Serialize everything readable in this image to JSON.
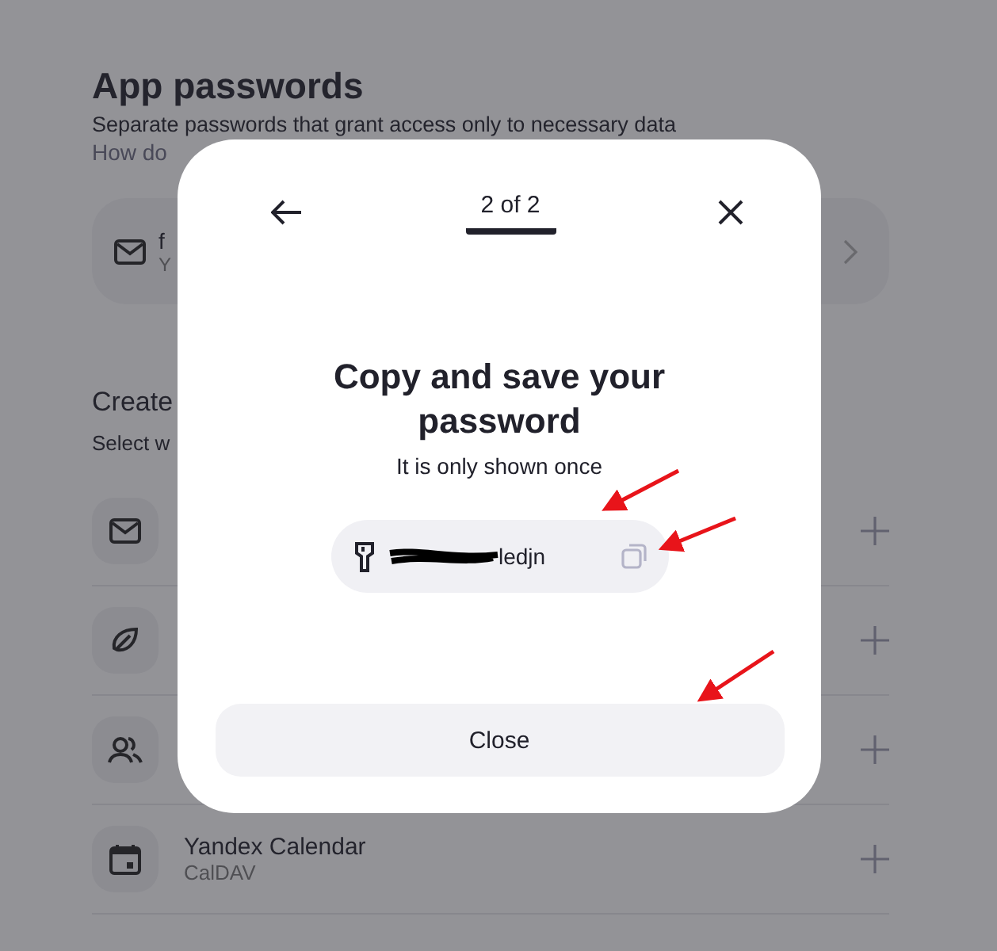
{
  "page": {
    "title": "App passwords",
    "description": "Separate passwords that grant access only to necessary data",
    "link": "How do",
    "existing_card": {
      "name": "f",
      "subtitle": "Y"
    },
    "create_heading": "Create",
    "create_hint": "Select w",
    "services": [
      {
        "kind": "mail"
      },
      {
        "kind": "disk"
      },
      {
        "kind": "contacts"
      },
      {
        "kind": "calendar",
        "name": "Yandex Calendar",
        "protocol": "CalDAV"
      }
    ]
  },
  "dialog": {
    "step": "2 of 2",
    "title": "Copy and save your password",
    "hint": "It is only shown once",
    "password": "ledjn",
    "close_button": "Close"
  },
  "annotations": [
    {
      "kind": "arrow"
    },
    {
      "kind": "arrow"
    },
    {
      "kind": "arrow"
    }
  ]
}
